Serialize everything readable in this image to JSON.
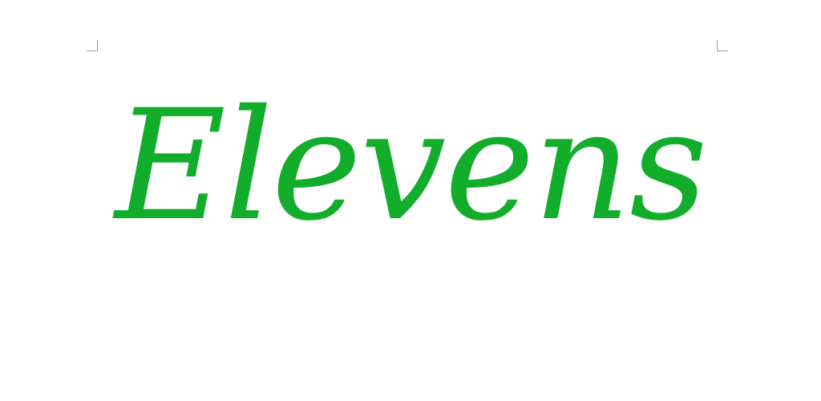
{
  "document": {
    "title_word": "Elevens",
    "title_color": "#12ad2b"
  }
}
